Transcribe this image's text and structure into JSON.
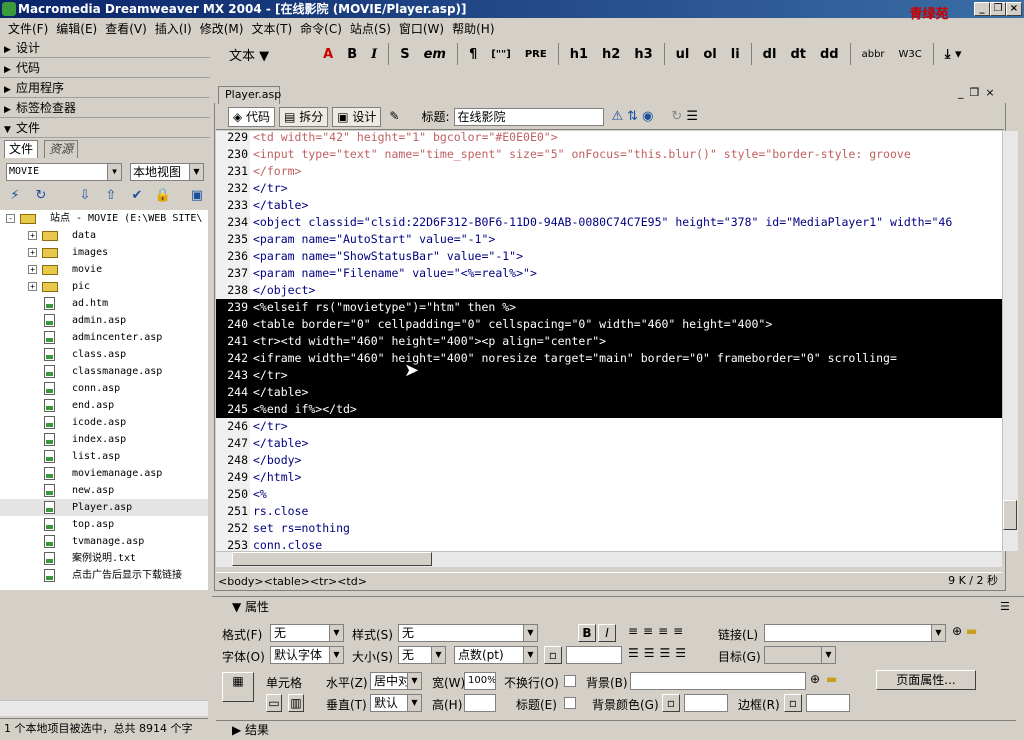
{
  "window": {
    "title": "Macromedia Dreamweaver MX 2004 - [在线影院 (MOVIE/Player.asp)]",
    "logo_text": "青绿苑"
  },
  "menu": [
    "文件(F)",
    "编辑(E)",
    "查看(V)",
    "插入(I)",
    "修改(M)",
    "文本(T)",
    "命令(C)",
    "站点(S)",
    "窗口(W)",
    "帮助(H)"
  ],
  "panels": {
    "design": "设计",
    "code": "代码",
    "app": "应用程序",
    "tag_inspector": "标签检查器",
    "files": "文件",
    "tab_files": "文件",
    "tab_assets": "资源",
    "site_select": "MOVIE",
    "view_select": "本地视图"
  },
  "tree": [
    {
      "label": "站点 - MOVIE (E:\\WEB SITE\\",
      "type": "site",
      "level": 0,
      "exp": "-"
    },
    {
      "label": "data",
      "type": "folder",
      "level": 1,
      "exp": "+"
    },
    {
      "label": "images",
      "type": "folder",
      "level": 1,
      "exp": "+"
    },
    {
      "label": "movie",
      "type": "folder",
      "level": 1,
      "exp": "+"
    },
    {
      "label": "pic",
      "type": "folder",
      "level": 1,
      "exp": "+"
    },
    {
      "label": "ad.htm",
      "type": "file",
      "level": 1
    },
    {
      "label": "admin.asp",
      "type": "file",
      "level": 1
    },
    {
      "label": "admincenter.asp",
      "type": "file",
      "level": 1
    },
    {
      "label": "class.asp",
      "type": "file",
      "level": 1
    },
    {
      "label": "classmanage.asp",
      "type": "file",
      "level": 1
    },
    {
      "label": "conn.asp",
      "type": "file",
      "level": 1
    },
    {
      "label": "end.asp",
      "type": "file",
      "level": 1
    },
    {
      "label": "icode.asp",
      "type": "file",
      "level": 1
    },
    {
      "label": "index.asp",
      "type": "file",
      "level": 1
    },
    {
      "label": "list.asp",
      "type": "file",
      "level": 1
    },
    {
      "label": "moviemanage.asp",
      "type": "file",
      "level": 1
    },
    {
      "label": "new.asp",
      "type": "file",
      "level": 1
    },
    {
      "label": "Player.asp",
      "type": "file",
      "level": 1,
      "selected": true
    },
    {
      "label": "top.asp",
      "type": "file",
      "level": 1
    },
    {
      "label": "tvmanage.asp",
      "type": "file",
      "level": 1
    },
    {
      "label": "案例说明.txt",
      "type": "file",
      "level": 1
    },
    {
      "label": "点击广告后显示下载链接",
      "type": "file",
      "level": 1
    }
  ],
  "left_status": "1 个本地项目被选中，总共 8914 个字",
  "insertbar": {
    "category": "文本",
    "buttons": [
      "B",
      "I",
      "S",
      "em",
      "¶",
      "[\"\"]",
      "PRE",
      "h1",
      "h2",
      "h3",
      "ul",
      "ol",
      "li",
      "dl",
      "dt",
      "dd",
      "abbr",
      "W3C"
    ]
  },
  "document": {
    "tab": "Player.asp",
    "view_code": "代码",
    "view_split": "拆分",
    "view_design": "设计",
    "title_label": "标题:",
    "title_value": "在线影院",
    "tag_path": "<body><table><tr><td>",
    "size": "9 K / 2 秒"
  },
  "code_lines": [
    {
      "n": "229",
      "text": "          <td width=\"42\" height=\"1\" bgcolor=\"#E0E0E0\">",
      "hl": false,
      "faded": true
    },
    {
      "n": "230",
      "text": "          <input type=\"text\" name=\"time_spent\" size=\"5\" onFocus=\"this.blur()\" style=\"border-style: groove",
      "hl": false,
      "faded": true
    },
    {
      "n": "231",
      "text": "          </form>",
      "hl": false,
      "faded": true
    },
    {
      "n": "232",
      "text": "        </tr>",
      "hl": false
    },
    {
      "n": "233",
      "text": "      </table>",
      "hl": false
    },
    {
      "n": "234",
      "text": "      <object classid=\"clsid:22D6F312-B0F6-11D0-94AB-0080C74C7E95\" height=\"378\" id=\"MediaPlayer1\" width=\"46",
      "hl": false
    },
    {
      "n": "235",
      "text": "        <param name=\"AutoStart\" value=\"-1\">",
      "hl": false
    },
    {
      "n": "236",
      "text": "        <param name=\"ShowStatusBar\" value=\"-1\">",
      "hl": false
    },
    {
      "n": "237",
      "text": "        <param name=\"Filename\" value=\"<%=real%>\">",
      "hl": false
    },
    {
      "n": "238",
      "text": "      </object>",
      "hl": false
    },
    {
      "n": "239",
      "text": "    <%elseif rs(\"movietype\")=\"htm\" then %>",
      "hl": true
    },
    {
      "n": "240",
      "text": "      <table border=\"0\" cellpadding=\"0\" cellspacing=\"0\" width=\"460\" height=\"400\">",
      "hl": true
    },
    {
      "n": "241",
      "text": "      <tr><td width=\"460\" height=\"400\"><p align=\"center\">",
      "hl": true
    },
    {
      "n": "242",
      "text": "            <iframe width=\"460\" height=\"400\" noresize target=\"main\" border=\"0\" frameborder=\"0\" scrolling=",
      "hl": true
    },
    {
      "n": "243",
      "text": "        </tr>",
      "hl": true
    },
    {
      "n": "244",
      "text": "        </table>",
      "hl": true
    },
    {
      "n": "245",
      "text": "      <%end if%></td>",
      "hl": true
    },
    {
      "n": "246",
      "text": "      </tr>",
      "hl": false
    },
    {
      "n": "247",
      "text": "    </table>",
      "hl": false
    },
    {
      "n": "248",
      "text": "</body>",
      "hl": false
    },
    {
      "n": "249",
      "text": "</html>",
      "hl": false
    },
    {
      "n": "250",
      "text": "<%",
      "hl": false
    },
    {
      "n": "251",
      "text": "rs.close",
      "hl": false
    },
    {
      "n": "252",
      "text": "set rs=nothing",
      "hl": false
    },
    {
      "n": "253",
      "text": "conn.close",
      "hl": false
    }
  ],
  "properties": {
    "header": "属性",
    "format_label": "格式(F)",
    "format_value": "无",
    "style_label": "样式(S)",
    "style_value": "无",
    "link_label": "链接(L)",
    "link_value": "",
    "font_label": "字体(O)",
    "font_value": "默认字体",
    "size_label": "大小(S)",
    "size_value": "无",
    "unit_value": "点数(pt)",
    "target_label": "目标(G)",
    "cell_label": "单元格",
    "horz_label": "水平(Z)",
    "horz_value": "居中对",
    "width_label": "宽(W)",
    "width_value": "100%",
    "nowrap_label": "不换行(O)",
    "bg_label": "背景(B)",
    "page_props": "页面属性...",
    "vert_label": "垂直(T)",
    "vert_value": "默认",
    "height_label": "高(H)",
    "height_value": "",
    "header_label": "标题(E)",
    "bgcolor_label": "背景颜色(G)",
    "border_label": "边框(R)",
    "results": "结果"
  },
  "colors": {
    "highlight_bg": "#000000",
    "title_bar": "#0a246a",
    "tag": "#000080",
    "string": "#a00000"
  }
}
